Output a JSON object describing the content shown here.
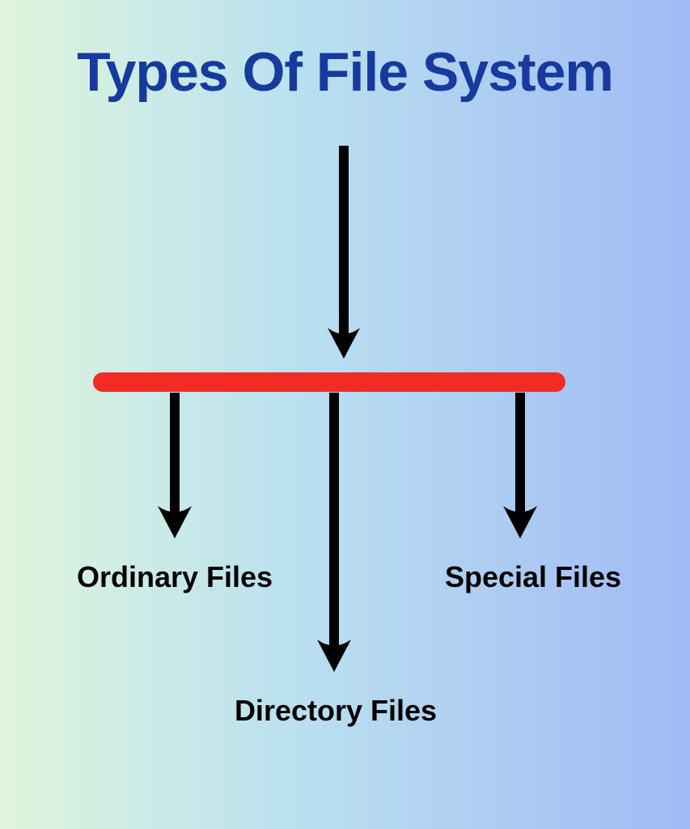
{
  "title": "Types Of File System",
  "branches": {
    "ordinary": "Ordinary Files",
    "directory": "Directory Files",
    "special": "Special Files"
  },
  "colors": {
    "title": "#163a9e",
    "bar": "#f22c24",
    "arrow": "#000000",
    "text": "#000000"
  }
}
